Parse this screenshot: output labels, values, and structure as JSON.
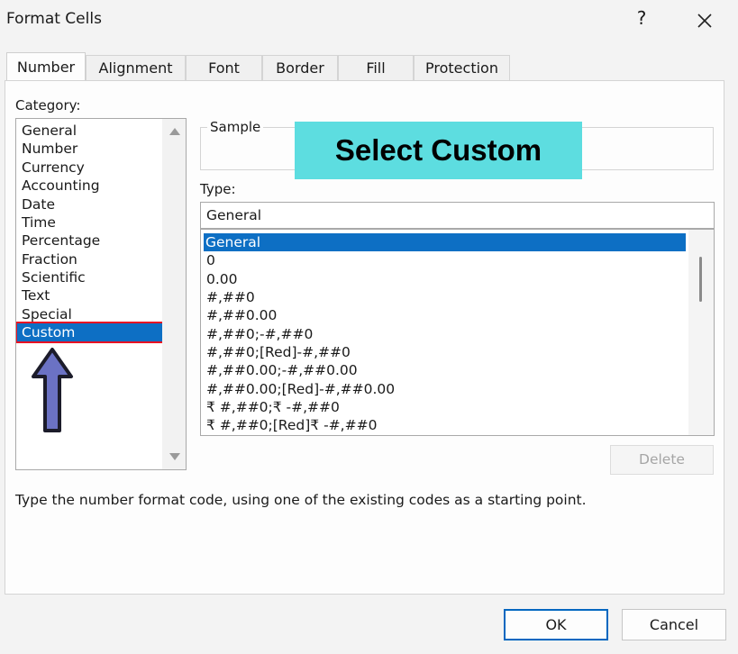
{
  "window": {
    "title": "Format Cells",
    "help_label": "?",
    "close_icon": "close-icon"
  },
  "tabs": [
    {
      "label": "Number",
      "active": true
    },
    {
      "label": "Alignment",
      "active": false
    },
    {
      "label": "Font",
      "active": false
    },
    {
      "label": "Border",
      "active": false
    },
    {
      "label": "Fill",
      "active": false
    },
    {
      "label": "Protection",
      "active": false
    }
  ],
  "category": {
    "label": "Category:",
    "items": [
      "General",
      "Number",
      "Currency",
      "Accounting",
      "Date",
      "Time",
      "Percentage",
      "Fraction",
      "Scientific",
      "Text",
      "Special",
      "Custom"
    ],
    "selected": "Custom"
  },
  "sample": {
    "label": "Sample"
  },
  "callout": {
    "text": "Select Custom",
    "color": "#5ddde0"
  },
  "type": {
    "label": "Type:",
    "value": "General",
    "items": [
      "General",
      "0",
      "0.00",
      "#,##0",
      "#,##0.00",
      "#,##0;-#,##0",
      "#,##0;[Red]-#,##0",
      "#,##0.00;-#,##0.00",
      "#,##0.00;[Red]-#,##0.00",
      "₹ #,##0;₹ -#,##0",
      "₹ #,##0;[Red]₹ -#,##0"
    ],
    "selected": "General"
  },
  "buttons": {
    "delete": "Delete",
    "ok": "OK",
    "cancel": "Cancel"
  },
  "hint": "Type the number format code, using one of the existing codes as a starting point.",
  "colors": {
    "selection": "#0d6fc4",
    "highlight_border": "#e81123",
    "arrow_fill": "#6b72c4",
    "ok_border": "#0067c0"
  }
}
